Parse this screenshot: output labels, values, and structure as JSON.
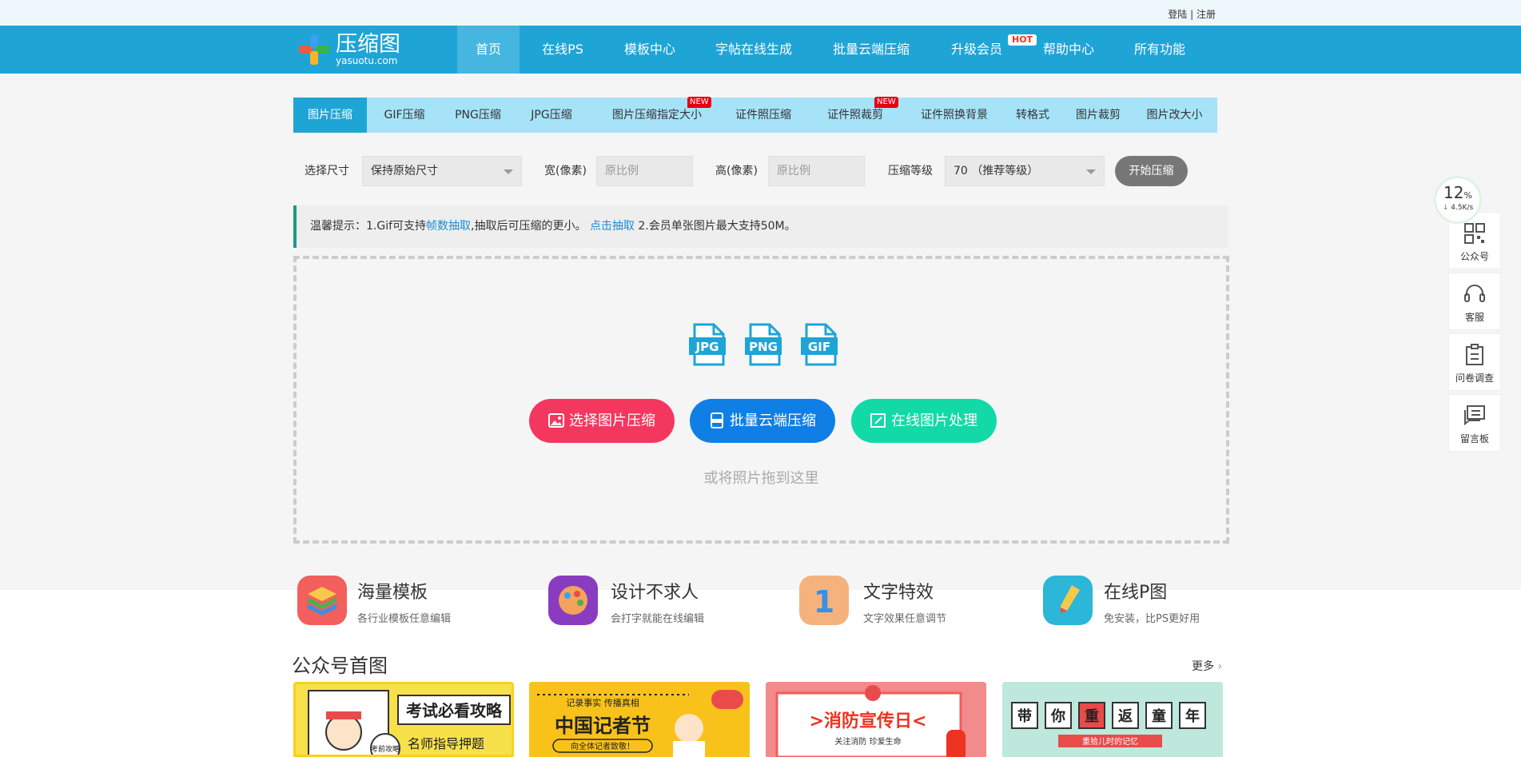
{
  "top_links": {
    "login": "登陆",
    "sep": " | ",
    "register": "注册"
  },
  "logo": {
    "cn": "压缩图",
    "en": "yasuotu.com"
  },
  "nav": {
    "items": [
      "首页",
      "在线PS",
      "模板中心",
      "字帖在线生成",
      "批量云端压缩",
      "升级会员",
      "帮助中心",
      "所有功能"
    ],
    "hot_badge": "HOT"
  },
  "tabs": {
    "items": [
      "图片压缩",
      "GIF压缩",
      "PNG压缩",
      "JPG压缩",
      "图片压缩指定大小",
      "证件照压缩",
      "证件照裁剪",
      "证件照换背景",
      "转格式",
      "图片裁剪",
      "图片改大小"
    ],
    "new_badge": "NEW"
  },
  "options": {
    "size_label": "选择尺寸",
    "size_value": "保持原始尺寸",
    "width_label": "宽(像素)",
    "width_placeholder": "原比例",
    "height_label": "高(像素)",
    "height_placeholder": "原比例",
    "level_label": "压缩等级",
    "level_value": "70 （推荐等级）",
    "start_button": "开始压缩"
  },
  "tip": {
    "prefix": "温馨提示：1.Gif可支持",
    "link1": "帧数抽取",
    "middle": ",抽取后可压缩的更小。 ",
    "link2": "点击抽取",
    "suffix": " 2.会员单张图片最大支持50M。"
  },
  "upload": {
    "file_types": [
      "JPG",
      "PNG",
      "GIF"
    ],
    "btn_select": "选择图片压缩",
    "btn_batch": "批量云端压缩",
    "btn_online": "在线图片处理",
    "drag_hint": "或将照片拖到这里"
  },
  "features": [
    {
      "title": "海量模板",
      "sub": "各行业模板任意编辑"
    },
    {
      "title": "设计不求人",
      "sub": "会打字就能在线编辑"
    },
    {
      "title": "文字特效",
      "sub": "文字效果任意调节"
    },
    {
      "title": "在线P图",
      "sub": "免安装，比PS更好用"
    }
  ],
  "section": {
    "title": "公众号首图",
    "more": "更多"
  },
  "cards": [
    {
      "heading": "考试必看攻略",
      "line": "名师指导押题",
      "tag": "考前攻略"
    },
    {
      "heading": "中国记者节",
      "top": "记录事实 传播真相",
      "sub": "向全体记者致敬！"
    },
    {
      "heading": ">消防宣传日<",
      "sub": "关注消防 珍爱生命"
    },
    {
      "chars": [
        "带",
        "你",
        "重",
        "返",
        "童",
        "年"
      ],
      "sub": "重拾儿时的记忆"
    }
  ],
  "sidebar": [
    "公众号",
    "客服",
    "问卷调查",
    "留言板"
  ],
  "speed": {
    "percent": "12",
    "unit": "%",
    "rate": "4.5K/s"
  },
  "colors": {
    "nav": "#1fa4d6",
    "tabs": "#a6e3f8",
    "btn_select": "#f4375e",
    "btn_batch": "#0f7fe6",
    "btn_online": "#13d9a6"
  }
}
